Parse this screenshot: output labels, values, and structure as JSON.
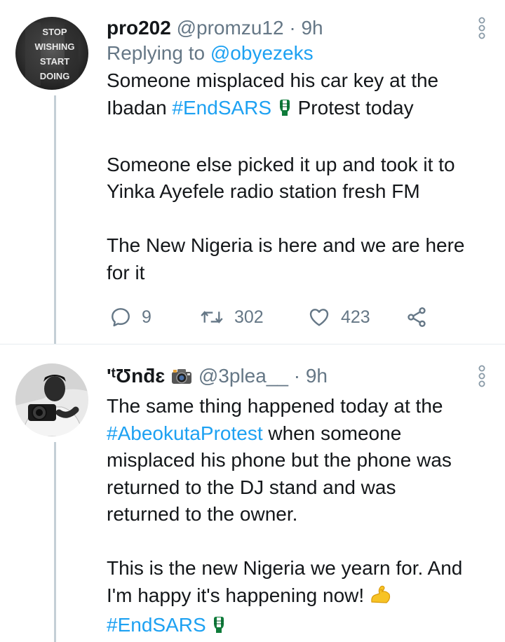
{
  "tweets": [
    {
      "author": {
        "display_name": "pro202",
        "handle": "@promzu12",
        "separator": "·",
        "time": "9h",
        "avatar_text": [
          "STOP",
          "WISHING",
          "START",
          "DOING"
        ]
      },
      "replying_to": {
        "prefix": "Replying to",
        "handle": "@obyezeks"
      },
      "text": {
        "l1": "Someone misplaced his car key at the",
        "l2a": "Ibadan ",
        "l2_hashtag": "#EndSARS",
        "l2b": " Protest today",
        "l3": "Someone else picked it up and took it to",
        "l4": "Yinka Ayefele radio station fresh FM",
        "l5": "The New Nigeria is here and we are here",
        "l6": "for it"
      },
      "stats": {
        "replies": "9",
        "retweets": "302",
        "likes": "423"
      },
      "icons": [
        "reply-icon",
        "retweet-icon",
        "like-icon",
        "share-icon",
        "more-options-icon",
        "raised-fist-flag-emoji"
      ]
    },
    {
      "author": {
        "display_name": "'ᵗƱnƌɛ",
        "handle": "@3plea__",
        "separator": "·",
        "time": "9h"
      },
      "text": {
        "l1": "The same thing happened today at the",
        "l2_hashtag": "#AbeokutaProtest",
        "l2b": " when someone",
        "l3": "misplaced his phone but the phone was",
        "l4": "returned to the DJ stand and was",
        "l5": "returned to the owner.",
        "l6": "This is the new Nigeria we yearn for. And",
        "l7": "I'm happy it's happening now! ",
        "l8_hashtag": "#EndSARS"
      },
      "icons": [
        "camera-emoji",
        "flexed-biceps-emoji",
        "raised-fist-flag-emoji",
        "more-options-icon"
      ]
    }
  ],
  "colors": {
    "link": "#1da1f2",
    "secondary_text": "#657786",
    "primary_text": "#14171a",
    "thread_line": "#c4cfd6",
    "emoji_green": "#0f7b3a"
  }
}
